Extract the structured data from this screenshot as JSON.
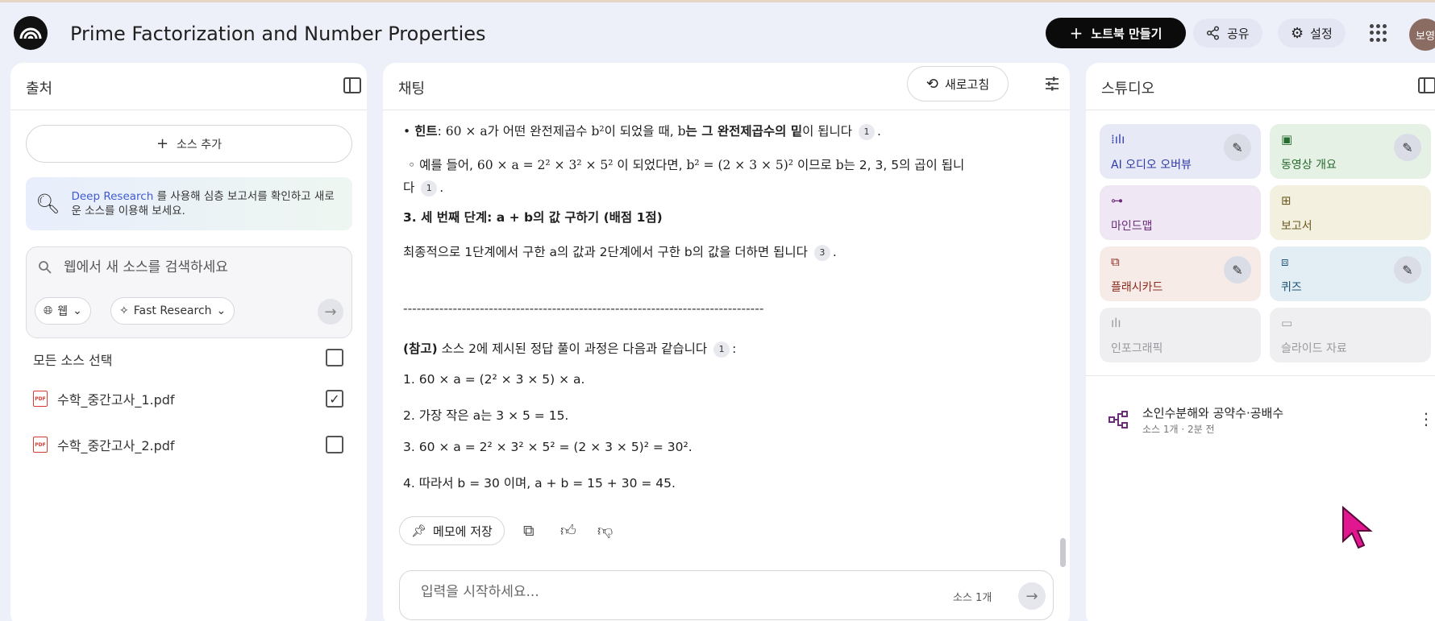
{
  "header": {
    "title": "Prime Factorization and Number Properties",
    "create_label": "노트북 만들기",
    "share_label": "공유",
    "settings_label": "설정",
    "avatar_text": "보영"
  },
  "sources": {
    "title": "출처",
    "add_label": "소스 추가",
    "deep_research_link": "Deep Research",
    "deep_research_text": "를 사용해 심층 보고서를 확인하고 새로운 소스를 이용해 보세요.",
    "search_placeholder": "웹에서 새 소스를 검색하세요",
    "web_chip": "웹",
    "fast_chip": "Fast Research",
    "select_all_label": "모든 소스 선택",
    "items": [
      {
        "name": "수학_중간고사_1.pdf",
        "checked": true
      },
      {
        "name": "수학_중간고사_2.pdf",
        "checked": false
      }
    ]
  },
  "chat": {
    "title": "채팅",
    "refresh_label": "새로고침",
    "hint_label": "힌트",
    "hint_text_a": ": ",
    "hint_math1": "60 × a",
    "hint_text_b": "가 어떤 완전제곱수 ",
    "hint_math2": "b²",
    "hint_text_c": "이 되었을 때, ",
    "hint_math3": "b",
    "hint_bold": "는 그 완전제곱수의 밑",
    "hint_text_d": "이 됩니다",
    "example_prefix": "예를 들어, ",
    "example_math1": "60 × a = 2² × 3² × 5²",
    "example_mid": " 이 되었다면, ",
    "example_math2": "b² = (2 × 3 × 5)²",
    "example_mid2": " 이므로 ",
    "example_math3": "b",
    "example_suffix": "는 2, 3, 5의 곱이 됩니",
    "example_line2": "다",
    "step3_heading": "3. 세 번째 단계: a + b의 값 구하기 (배점 1점)",
    "step3_text": "최종적으로 1단계에서 구한 a의 값과 2단계에서 구한 b의 값을 더하면 됩니다",
    "divider": "--------------------------------------------------------------------------------",
    "ref_bold": "(참고)",
    "ref_text": " 소스 2에 제시된 정답 풀이 과정은 다음과 같습니다",
    "steps": [
      "1. 60 × a = (2² × 3 × 5) × a.",
      "2. 가장 작은 a는 3 × 5 = 15.",
      "3. 60 × a = 2² × 3² × 5² = (2 × 3 × 5)² = 30².",
      "4. 따라서 b = 30 이며, a + b = 15 + 30 = 45."
    ],
    "cite_1": "1",
    "cite_3": "3",
    "save_memo_label": "메모에 저장",
    "input_placeholder": "입력을 시작하세요...",
    "source_count": "소스 1개"
  },
  "studio": {
    "title": "스튜디오",
    "tiles": [
      {
        "label": "AI 오디오 오버뷰"
      },
      {
        "label": "동영상 개요"
      },
      {
        "label": "마인드맵"
      },
      {
        "label": "보고서"
      },
      {
        "label": "플래시카드"
      },
      {
        "label": "퀴즈"
      },
      {
        "label": "인포그래픽"
      },
      {
        "label": "슬라이드 자료"
      }
    ],
    "note_title": "소인수분해와 공약수·공배수",
    "note_meta": "소스 1개 · 2분 전"
  }
}
